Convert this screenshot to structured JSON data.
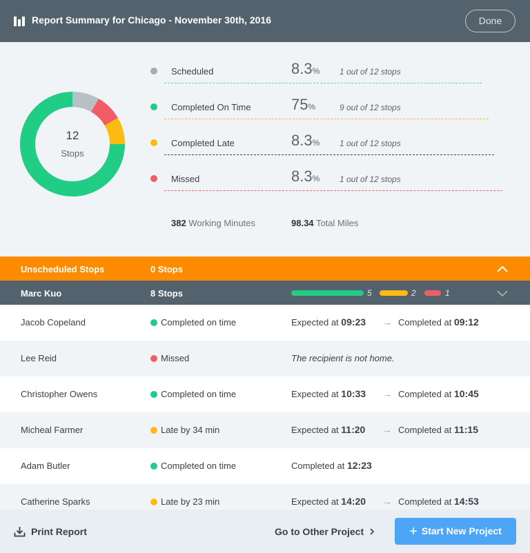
{
  "header": {
    "title": "Report Summary for Chicago - November 30th, 2016",
    "done_label": "Done"
  },
  "summary": {
    "total_stops": "12",
    "total_label": "Stops",
    "stats": [
      {
        "label": "Scheduled",
        "pct": "8.3",
        "unit": "%",
        "count": "1 out of 12 stops",
        "color": "#a3adb2"
      },
      {
        "label": "Completed On Time",
        "pct": "75",
        "unit": "%",
        "count": "9 out of 12 stops",
        "color": "#21cc85"
      },
      {
        "label": "Completed Late",
        "pct": "8.3",
        "unit": "%",
        "count": "1 out of 12 stops",
        "color": "#fdbb11"
      },
      {
        "label": "Missed",
        "pct": "8.3",
        "unit": "%",
        "count": "1 out of 12 stops",
        "color": "#f15d66"
      }
    ],
    "working_minutes_value": "382",
    "working_minutes_label": "Working Minutes",
    "total_miles_value": "98.34",
    "total_miles_label": "Total Miles"
  },
  "chart_data": {
    "type": "pie",
    "categories": [
      "Scheduled",
      "Completed On Time",
      "Completed Late",
      "Missed"
    ],
    "values": [
      1,
      9,
      1,
      1
    ],
    "colors": [
      "#b7c1c5",
      "#21cc85",
      "#fdbb11",
      "#f15d66"
    ]
  },
  "unscheduled": {
    "label": "Unscheduled Stops",
    "stops": "0 Stops"
  },
  "driver": {
    "name": "Marc Kuo",
    "stops": "8 Stops",
    "on_time_count": "5",
    "late_count": "2",
    "missed_count": "1",
    "on_time_color": "#21cc85",
    "late_color": "#fdbb11",
    "missed_color": "#f15d66"
  },
  "rows": [
    {
      "name": "Jacob Copeland",
      "status": "Completed on time",
      "status_color": "#21cc85",
      "expected_prefix": "Expected at",
      "expected": "09:23",
      "completed_prefix": "Completed at",
      "completed": "09:12"
    },
    {
      "name": "Lee Reid",
      "status": "Missed",
      "status_color": "#f15d66",
      "note": "The recipient is not home."
    },
    {
      "name": "Christopher Owens",
      "status": "Completed on time",
      "status_color": "#21cc85",
      "expected_prefix": "Expected at",
      "expected": "10:33",
      "completed_prefix": "Completed at",
      "completed": "10:45"
    },
    {
      "name": "Micheal Farmer",
      "status": "Late by 34 min",
      "status_color": "#fdbb11",
      "expected_prefix": "Expected at",
      "expected": "11:20",
      "completed_prefix": "Completed at",
      "completed": "11:15"
    },
    {
      "name": "Adam Butler",
      "status": "Completed on time",
      "status_color": "#21cc85",
      "completed_prefix": "Completed at",
      "completed": "12:23"
    },
    {
      "name": "Catherine Sparks",
      "status": "Late by 23 min",
      "status_color": "#fdbb11",
      "expected_prefix": "Expected at",
      "expected": "14:20",
      "completed_prefix": "Completed at",
      "completed": "14:53"
    }
  ],
  "footer": {
    "print_label": "Print Report",
    "other_project_label": "Go to Other Project",
    "start_label": "Start New Project"
  }
}
